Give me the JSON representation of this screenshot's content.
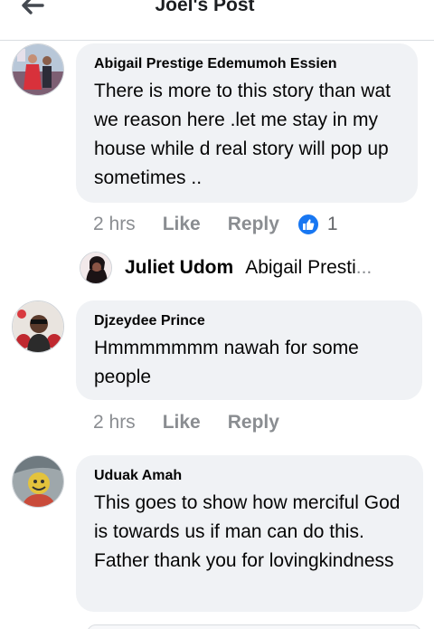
{
  "header": {
    "title": "Joel's Post",
    "back_icon": "arrow-left-icon"
  },
  "colors": {
    "bubble": "#f0f2f5",
    "like_blue": "#1877f2",
    "meta_gray": "#8a8d91"
  },
  "comments": [
    {
      "author": "Abigail Prestige Edemumoh Essien",
      "text": "There is more to this story than wat we reason here .let me stay in my house while d real story will pop up sometimes ..",
      "time": "2 hrs",
      "like": "Like",
      "reply": "Reply",
      "reaction_count": "1"
    },
    {
      "author": "Djzeydee Prince",
      "text": "Hmmmmmmm nawah for some people",
      "time": "2 hrs",
      "like": "Like",
      "reply": "Reply"
    },
    {
      "author": "Uduak Amah",
      "text": "This goes to show how merciful God is towards us if man can do this. Father thank you for lovingkindness"
    }
  ],
  "reply_preview": {
    "author": "Juliet Udom",
    "snippet": "Abigail Presti",
    "ellipsis": "..."
  }
}
